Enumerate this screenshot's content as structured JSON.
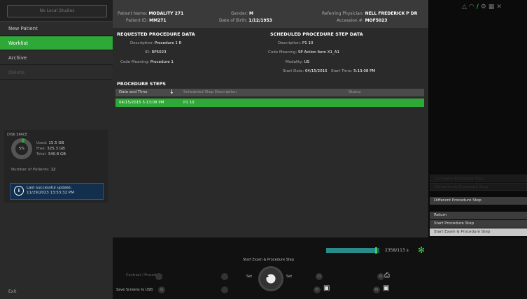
{
  "sidebar": {
    "header_button": "No Local Studies",
    "items": [
      {
        "label": "New Patient"
      },
      {
        "label": "Worklist"
      },
      {
        "label": "Archive"
      },
      {
        "label": "Delete"
      }
    ],
    "disk": {
      "title": "DISK SPACE",
      "percent": "5%",
      "used_label": "Used:",
      "used": "15.5 GB",
      "free_label": "Free:",
      "free": "325.3 GB",
      "total_label": "Total:",
      "total": "340.8 GB"
    },
    "patients_label": "Number of Patients:",
    "patients_count": "12",
    "update": {
      "line1": "Last successful update:",
      "line2": "11/29/2023 13:53:32 PM"
    },
    "exit": "Exit"
  },
  "patient": {
    "name_label": "Patient Name:",
    "name": "MODALITY 271",
    "id_label": "Patient ID:",
    "id": "MM271",
    "gender_label": "Gender:",
    "gender": "M",
    "dob_label": "Date of Birth:",
    "dob": "1/12/1953",
    "physician_label": "Referring Physician:",
    "physician": "NELL FREDERICK P DR",
    "accession_label": "Accession #:",
    "accession": "MOF5023"
  },
  "requested": {
    "title": "REQUESTED PROCEDURE DATA",
    "desc_label": "Description:",
    "desc": "Procedure 1 R",
    "id_label": "ID:",
    "id": "RP5023",
    "meaning_label": "Code Meaning:",
    "meaning": "Procedure 1"
  },
  "scheduled": {
    "title": "SCHEDULED PROCEDURE STEP DATA",
    "desc_label": "Description:",
    "desc": "P1 10",
    "meaning_label": "Code Meaning:",
    "meaning": "SP Action Item X1_A1",
    "modality_label": "Modality:",
    "modality": "US",
    "date_label": "Start Date:",
    "date": "04/15/2015",
    "time_label": "Start Time:",
    "time": "5:13:08 PM"
  },
  "steps": {
    "title": "PROCEDURE STEPS",
    "columns": [
      "Date and Time",
      "Scheduled Step Description",
      "Status"
    ],
    "rows": [
      {
        "datetime": "04/15/2015 5:13:08 PM",
        "desc": "P1 10",
        "status": ""
      }
    ]
  },
  "right_panel": {
    "disabled": [
      "Complete Procedure Step",
      "Discontinue Procedure Step"
    ],
    "different": "Different Procedure Step",
    "actions": [
      "Return",
      "Start Procedure Step",
      "Start Exam & Procedure Step"
    ]
  },
  "bottom": {
    "progress_text": "2358/113 s",
    "progress_fraction": 0.92,
    "start_label": "Start Exam & Procedure Step",
    "set_left": "Set",
    "set_right": "Set",
    "save_label": "Save Screens to USB",
    "contrast_label": "Contrast / Procedure"
  }
}
